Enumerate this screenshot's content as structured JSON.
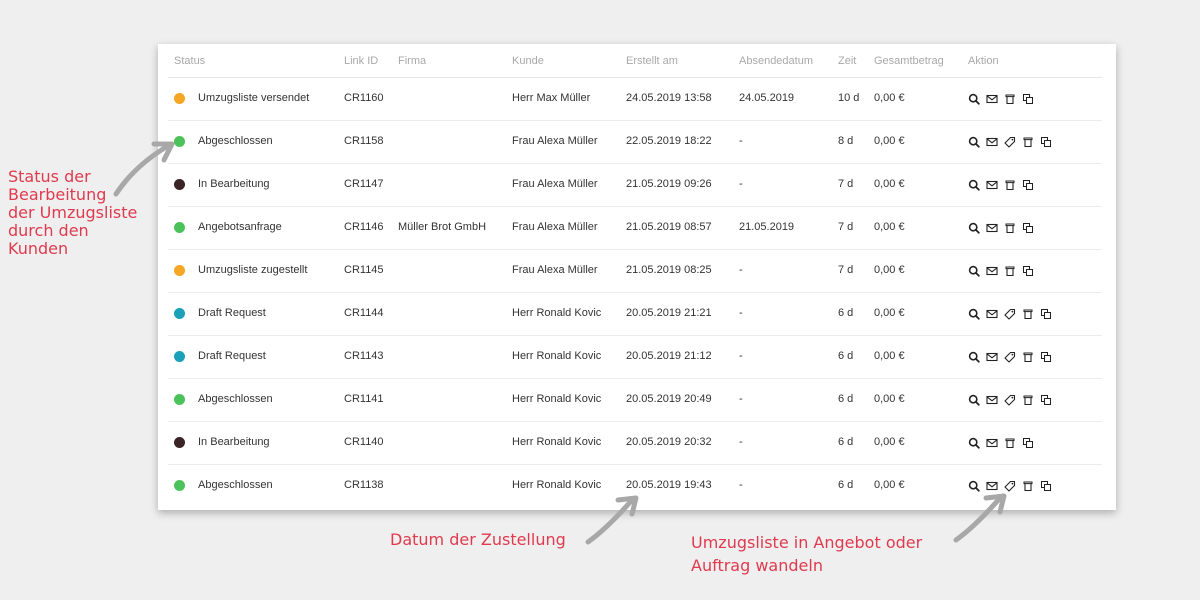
{
  "table": {
    "headers": {
      "status": "Status",
      "link_id": "Link ID",
      "firma": "Firma",
      "kunde": "Kunde",
      "erstellt_am": "Erstellt am",
      "absendedatum": "Absendedatum",
      "zeit": "Zeit",
      "gesamtbetrag": "Gesamtbetrag",
      "aktion": "Aktion"
    },
    "rows": [
      {
        "status": "Umzugsliste versendet",
        "color": "#f5a623",
        "link_id": "CR1160",
        "firma": "",
        "kunde": "Herr Max Müller",
        "erstellt_am": "24.05.2019 13:58",
        "absendedatum": "24.05.2019",
        "zeit": "10 d",
        "gesamtbetrag": "0,00 €",
        "actions": [
          "search-icon",
          "mail-icon",
          "trash-icon",
          "copy-icon"
        ]
      },
      {
        "status": "Abgeschlossen",
        "color": "#4cc25a",
        "link_id": "CR1158",
        "firma": "",
        "kunde": "Frau Alexa Müller",
        "erstellt_am": "22.05.2019 18:22",
        "absendedatum": "-",
        "zeit": "8 d",
        "gesamtbetrag": "0,00 €",
        "actions": [
          "search-icon",
          "mail-icon",
          "tag-icon",
          "trash-icon",
          "copy-icon"
        ]
      },
      {
        "status": "In Bearbeitung",
        "color": "#3b2425",
        "link_id": "CR1147",
        "firma": "",
        "kunde": "Frau Alexa Müller",
        "erstellt_am": "21.05.2019 09:26",
        "absendedatum": "-",
        "zeit": "7 d",
        "gesamtbetrag": "0,00 €",
        "actions": [
          "search-icon",
          "mail-icon",
          "trash-icon",
          "copy-icon"
        ]
      },
      {
        "status": "Angebotsanfrage",
        "color": "#4cc25a",
        "link_id": "CR1146",
        "firma": "Müller Brot GmbH",
        "kunde": "Frau Alexa Müller",
        "erstellt_am": "21.05.2019 08:57",
        "absendedatum": "21.05.2019",
        "zeit": "7 d",
        "gesamtbetrag": "0,00 €",
        "actions": [
          "search-icon",
          "mail-icon",
          "trash-icon",
          "copy-icon"
        ]
      },
      {
        "status": "Umzugsliste zugestellt",
        "color": "#f5a623",
        "link_id": "CR1145",
        "firma": "",
        "kunde": "Frau Alexa Müller",
        "erstellt_am": "21.05.2019 08:25",
        "absendedatum": "-",
        "zeit": "7 d",
        "gesamtbetrag": "0,00 €",
        "actions": [
          "search-icon",
          "mail-icon",
          "trash-icon",
          "copy-icon"
        ]
      },
      {
        "status": "Draft Request",
        "color": "#1aa0b8",
        "link_id": "CR1144",
        "firma": "",
        "kunde": "Herr Ronald Kovic",
        "erstellt_am": "20.05.2019 21:21",
        "absendedatum": "-",
        "zeit": "6 d",
        "gesamtbetrag": "0,00 €",
        "actions": [
          "search-icon",
          "mail-icon",
          "tag-icon",
          "trash-icon",
          "copy-icon"
        ]
      },
      {
        "status": "Draft Request",
        "color": "#1aa0b8",
        "link_id": "CR1143",
        "firma": "",
        "kunde": "Herr Ronald Kovic",
        "erstellt_am": "20.05.2019 21:12",
        "absendedatum": "-",
        "zeit": "6 d",
        "gesamtbetrag": "0,00 €",
        "actions": [
          "search-icon",
          "mail-icon",
          "tag-icon",
          "trash-icon",
          "copy-icon"
        ]
      },
      {
        "status": "Abgeschlossen",
        "color": "#4cc25a",
        "link_id": "CR1141",
        "firma": "",
        "kunde": "Herr Ronald Kovic",
        "erstellt_am": "20.05.2019 20:49",
        "absendedatum": "-",
        "zeit": "6 d",
        "gesamtbetrag": "0,00 €",
        "actions": [
          "search-icon",
          "mail-icon",
          "tag-icon",
          "trash-icon",
          "copy-icon"
        ]
      },
      {
        "status": "In Bearbeitung",
        "color": "#3b2425",
        "link_id": "CR1140",
        "firma": "",
        "kunde": "Herr Ronald Kovic",
        "erstellt_am": "20.05.2019 20:32",
        "absendedatum": "-",
        "zeit": "6 d",
        "gesamtbetrag": "0,00 €",
        "actions": [
          "search-icon",
          "mail-icon",
          "trash-icon",
          "copy-icon"
        ]
      },
      {
        "status": "Abgeschlossen",
        "color": "#4cc25a",
        "link_id": "CR1138",
        "firma": "",
        "kunde": "Herr Ronald Kovic",
        "erstellt_am": "20.05.2019 19:43",
        "absendedatum": "-",
        "zeit": "6 d",
        "gesamtbetrag": "0,00 €",
        "actions": [
          "search-icon",
          "mail-icon",
          "tag-icon",
          "trash-icon",
          "copy-icon"
        ]
      }
    ]
  },
  "annotations": {
    "status_line1": "Status der",
    "status_line2": "Bearbeitung",
    "status_line3": "der Umzugsliste",
    "status_line4": "durch den",
    "status_line5": "Kunden",
    "datum": "Datum der Zustellung",
    "wandeln_line1": "Umzugsliste in Angebot oder",
    "wandeln_line2": "Auftrag wandeln",
    "color": "#e03a4e"
  }
}
